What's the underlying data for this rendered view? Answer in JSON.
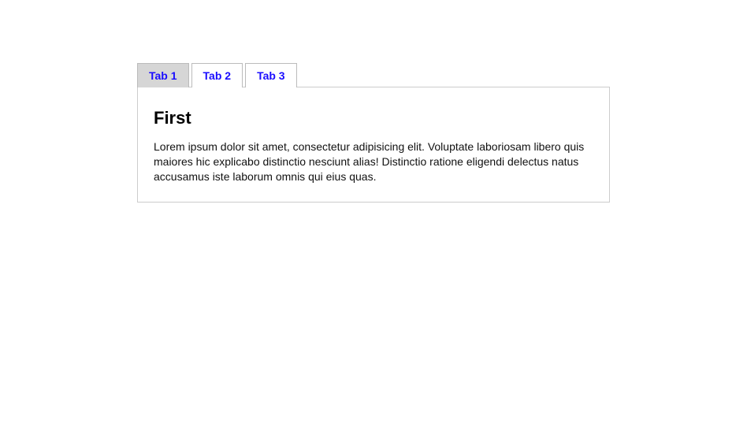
{
  "tabs": [
    {
      "label": "Tab 1",
      "active": true
    },
    {
      "label": "Tab 2",
      "active": false
    },
    {
      "label": "Tab 3",
      "active": false
    }
  ],
  "panel": {
    "heading": "First",
    "body": "Lorem ipsum dolor sit amet, consectetur adipisicing elit. Voluptate laboriosam libero quis maiores hic explicabo distinctio nesciunt alias! Distinctio ratione eligendi delectus natus accusamus iste laborum omnis qui eius quas."
  }
}
